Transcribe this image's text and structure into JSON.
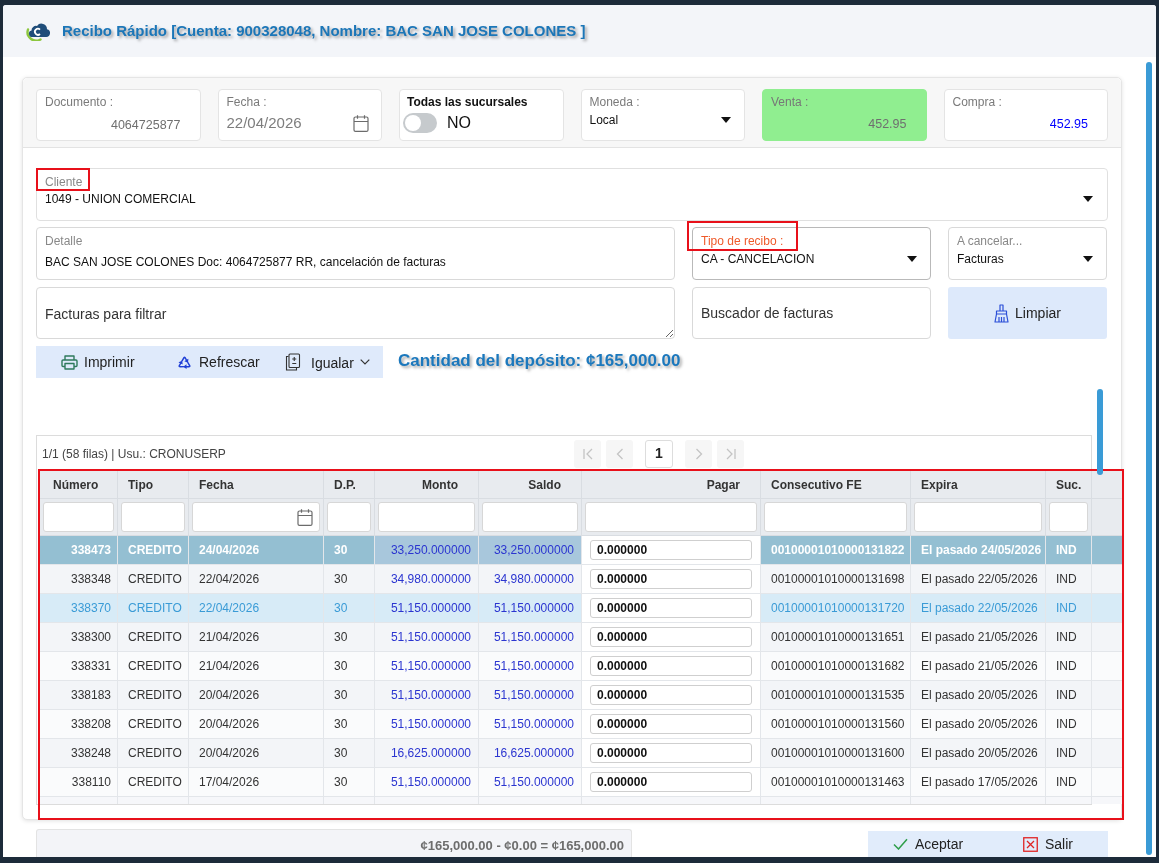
{
  "window": {
    "title": "Recibo Rápido [Cuenta: 900328048, Nombre: BAC SAN JOSE COLONES ]"
  },
  "header_fields": [
    {
      "kind": "number",
      "label": "Documento :",
      "value": "4064725877"
    },
    {
      "kind": "date",
      "label": "Fecha :",
      "value": "22/04/2026"
    },
    {
      "kind": "toggle",
      "label": "Todas las sucursales",
      "on": false,
      "value": "NO"
    },
    {
      "kind": "select",
      "label": "Moneda :",
      "value": "Local"
    },
    {
      "kind": "highlight",
      "label": "Venta :",
      "value": "452.95"
    },
    {
      "kind": "rate",
      "label": "Compra :",
      "value": "452.95"
    }
  ],
  "cliente": {
    "label": "Cliente",
    "value": "1049 - UNION COMERCIAL",
    "highlighted": true
  },
  "detalle": {
    "label": "Detalle",
    "value": "BAC SAN JOSE COLONES Doc: 4064725877 RR, cancelación de facturas"
  },
  "tipo_de_recibo": {
    "label": "Tipo de recibo :",
    "value": "CA - CANCELACION",
    "highlighted": true
  },
  "a_cancelar": {
    "label": "A cancelar...",
    "value": "Facturas"
  },
  "invoice_filter": {
    "placeholder": "Facturas para filtrar"
  },
  "invoice_search": {
    "placeholder": "Buscador de facturas"
  },
  "clear_button": {
    "label": "Limpiar"
  },
  "toolbar": [
    {
      "kind": "print",
      "label": "Imprimir",
      "dropdown": false
    },
    {
      "kind": "refresh",
      "label": "Refrescar",
      "dropdown": false
    },
    {
      "kind": "match",
      "label": "Igualar",
      "dropdown": true
    }
  ],
  "deposit_amount": "Cantidad del depósito: ¢165,000.00",
  "pager": {
    "info": "1/1 (58 filas) | Usu.: CRONUSERP",
    "nav_before": [
      {
        "kind": "first",
        "disabled": true
      },
      {
        "kind": "prev",
        "disabled": true
      }
    ],
    "pages": [
      {
        "label": "1",
        "selected": true
      }
    ],
    "nav_after": [
      {
        "kind": "next",
        "disabled": true
      },
      {
        "kind": "last",
        "disabled": true
      }
    ]
  },
  "table": {
    "highlighted": true,
    "columns": [
      {
        "label": "Número",
        "kind": "number"
      },
      {
        "label": "Tipo",
        "kind": "text"
      },
      {
        "label": "Fecha",
        "kind": "date"
      },
      {
        "label": "D.P.",
        "kind": "text"
      },
      {
        "label": "Monto",
        "kind": "amount"
      },
      {
        "label": "Saldo",
        "kind": "amount"
      },
      {
        "label": "Pagar",
        "kind": "input"
      },
      {
        "label": "Consecutivo FE",
        "kind": "text"
      },
      {
        "label": "Expira",
        "kind": "text"
      },
      {
        "label": "Suc.",
        "kind": "text"
      }
    ],
    "rows": [
      {
        "selected": true,
        "hovered": false,
        "cells": [
          "338473",
          "CREDITO",
          "24/04/2026",
          "30",
          "33,250.000000",
          "33,250.000000",
          "0.000000",
          "00100001010000131822",
          "El pasado 24/05/2026",
          "IND"
        ]
      },
      {
        "selected": false,
        "hovered": false,
        "cells": [
          "338348",
          "CREDITO",
          "22/04/2026",
          "30",
          "34,980.000000",
          "34,980.000000",
          "0.000000",
          "00100001010000131698",
          "El pasado 22/05/2026",
          "IND"
        ]
      },
      {
        "selected": false,
        "hovered": true,
        "cells": [
          "338370",
          "CREDITO",
          "22/04/2026",
          "30",
          "51,150.000000",
          "51,150.000000",
          "0.000000",
          "00100001010000131720",
          "El pasado 22/05/2026",
          "IND"
        ]
      },
      {
        "selected": false,
        "hovered": false,
        "cells": [
          "338300",
          "CREDITO",
          "21/04/2026",
          "30",
          "51,150.000000",
          "51,150.000000",
          "0.000000",
          "00100001010000131651",
          "El pasado 21/05/2026",
          "IND"
        ]
      },
      {
        "selected": false,
        "hovered": false,
        "cells": [
          "338331",
          "CREDITO",
          "21/04/2026",
          "30",
          "51,150.000000",
          "51,150.000000",
          "0.000000",
          "00100001010000131682",
          "El pasado 21/05/2026",
          "IND"
        ]
      },
      {
        "selected": false,
        "hovered": false,
        "cells": [
          "338183",
          "CREDITO",
          "20/04/2026",
          "30",
          "51,150.000000",
          "51,150.000000",
          "0.000000",
          "00100001010000131535",
          "El pasado 20/05/2026",
          "IND"
        ]
      },
      {
        "selected": false,
        "hovered": false,
        "cells": [
          "338208",
          "CREDITO",
          "20/04/2026",
          "30",
          "51,150.000000",
          "51,150.000000",
          "0.000000",
          "00100001010000131560",
          "El pasado 20/05/2026",
          "IND"
        ]
      },
      {
        "selected": false,
        "hovered": false,
        "cells": [
          "338248",
          "CREDITO",
          "20/04/2026",
          "30",
          "16,625.000000",
          "16,625.000000",
          "0.000000",
          "00100001010000131600",
          "El pasado 20/05/2026",
          "IND"
        ]
      },
      {
        "selected": false,
        "hovered": false,
        "cells": [
          "338110",
          "CREDITO",
          "17/04/2026",
          "30",
          "51,150.000000",
          "51,150.000000",
          "0.000000",
          "00100001010000131463",
          "El pasado 17/05/2026",
          "IND"
        ]
      }
    ]
  },
  "summary": "¢165,000.00 - ¢0.00 = ¢165,000.00",
  "actions": [
    {
      "kind": "accept",
      "label": "Aceptar"
    },
    {
      "kind": "exit",
      "label": "Salir"
    }
  ]
}
